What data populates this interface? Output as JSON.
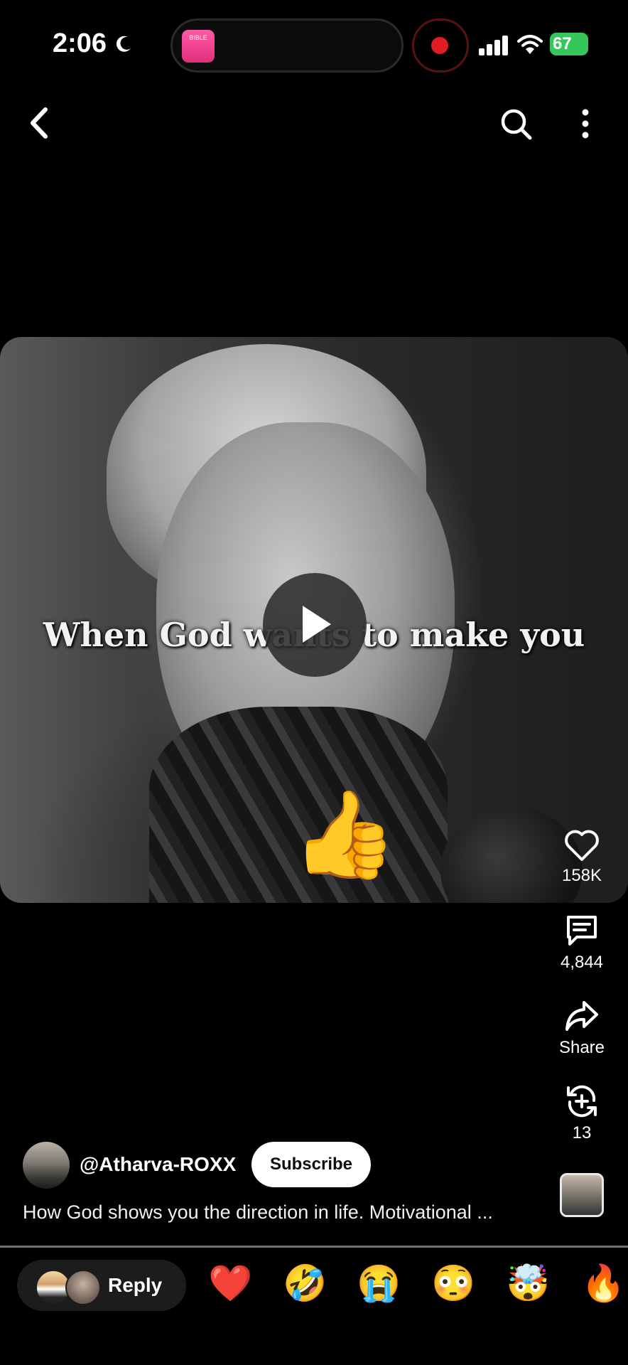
{
  "status_bar": {
    "time": "2:06",
    "battery": "67",
    "app_icon_text": "BIBLE"
  },
  "icons": {
    "back": "back-arrow-icon",
    "search": "search-icon",
    "more": "more-vertical-icon",
    "like": "heart-icon",
    "comment": "comment-icon",
    "share": "share-icon",
    "remix": "remix-icon"
  },
  "video": {
    "caption": "When God wants to make you",
    "overlay_emoji": "👍"
  },
  "actions": {
    "likes": "158K",
    "comments": "4,844",
    "share_label": "Share",
    "remix_count": "13"
  },
  "channel": {
    "handle": "@Atharva-ROXX",
    "subscribe_label": "Subscribe",
    "description": "How God shows you the direction in life. Motivational ..."
  },
  "reply_bar": {
    "reply_label": "Reply",
    "reactions": [
      "❤️",
      "🤣",
      "😭",
      "😳",
      "🤯",
      "🔥"
    ]
  },
  "colors": {
    "background": "#000000",
    "subscribe_bg": "#ffffff",
    "record_red": "#e01b24",
    "battery_green": "#34c759"
  }
}
